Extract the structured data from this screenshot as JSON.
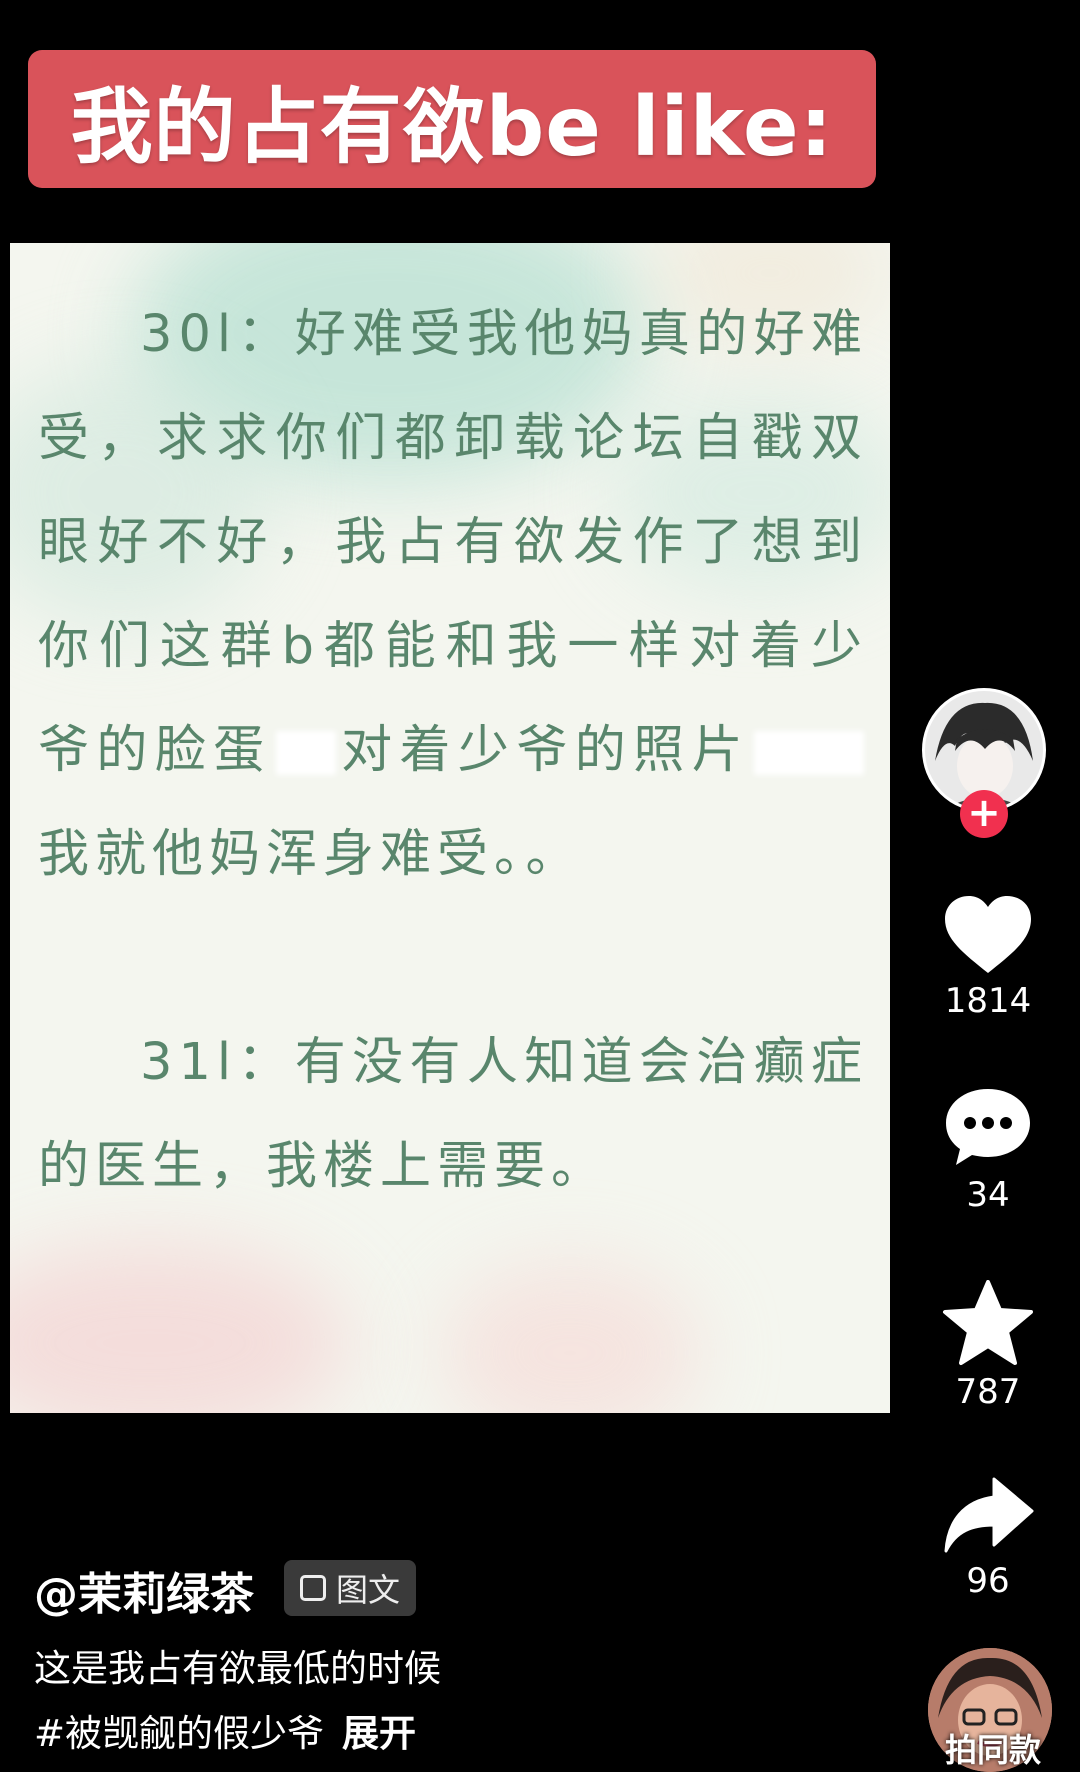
{
  "banner": {
    "title": "我的占有欲be like:"
  },
  "post": {
    "paragraph1_prefix": "30l：好难受我他妈真的好难受，求求你们都卸载论坛自戳双眼好不好，我占有欲发作了想到你们这群b都能和我一样对着少爷的脸蛋",
    "paragraph1_mid": "对着少爷的照片",
    "paragraph1_suffix": "我就他妈浑身难受。。",
    "paragraph2": "31l：有没有人知道会治癫症的医生，我楼上需要。"
  },
  "actions": {
    "likes": "1814",
    "comments": "34",
    "favorites": "787",
    "shares": "96"
  },
  "author": {
    "username": "@茉莉绿茶",
    "content_type": "图文",
    "caption": "这是我占有欲最低的时候",
    "hashtag": "#被觊觎的假少爷",
    "expand": "展开"
  },
  "music": {
    "label": "拍同款"
  },
  "icons": [
    "follow-plus-icon",
    "heart-icon",
    "comment-icon",
    "star-icon",
    "share-icon",
    "image-text-icon"
  ],
  "colors": {
    "banner": "#d9535a",
    "post_text": "#59866c",
    "follow": "#f1304f"
  }
}
